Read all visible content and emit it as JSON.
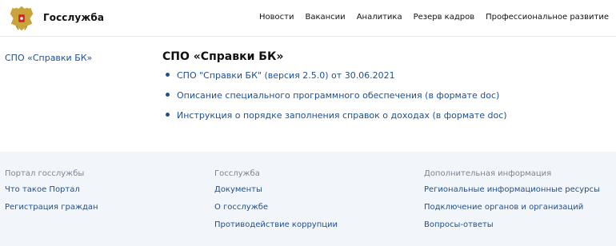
{
  "header": {
    "brand": "Госслужба",
    "nav": [
      "Новости",
      "Вакансии",
      "Аналитика",
      "Резерв кадров",
      "Профессиональное развитие"
    ]
  },
  "sidebar": {
    "link": "СПО «Справки БК»"
  },
  "main": {
    "title": "СПО «Справки БК»",
    "items": [
      "СПО \"Справки БК\" (версия 2.5.0) от 30.06.2021",
      "Описание специального программного обеспечения (в формате doc)",
      "Инструкция о порядке заполнения справок о доходах (в формате doc)"
    ]
  },
  "footer": {
    "columns": [
      {
        "title": "Портал госслужбы",
        "links": [
          "Что такое Портал",
          "Регистрация граждан"
        ]
      },
      {
        "title": "Госслужба",
        "links": [
          "Документы",
          "О госслужбе",
          "Противодействие коррупции"
        ]
      },
      {
        "title": "Дополнительная информация",
        "links": [
          "Региональные информационные ресурсы",
          "Подключение органов и организаций",
          "Вопросы-ответы"
        ]
      }
    ]
  },
  "colors": {
    "link": "#1e4f91",
    "footer_bg": "#f2f6fa",
    "muted": "#7a8594"
  }
}
